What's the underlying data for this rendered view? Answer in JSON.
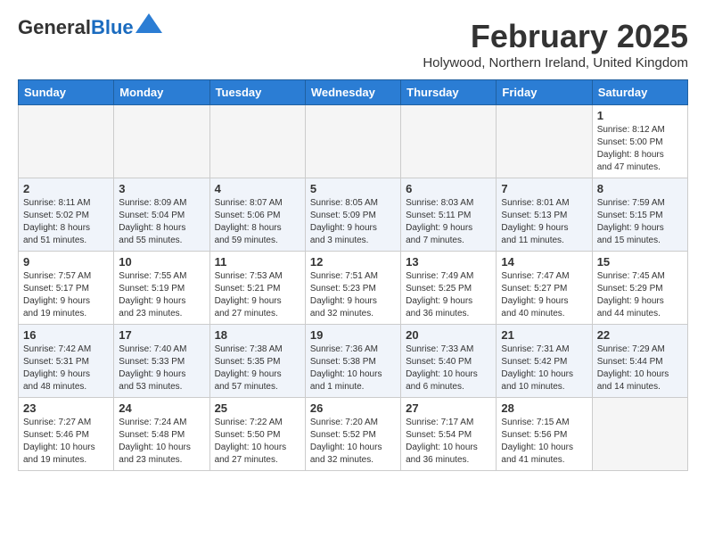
{
  "logo": {
    "general": "General",
    "blue": "Blue"
  },
  "title": "February 2025",
  "location": "Holywood, Northern Ireland, United Kingdom",
  "days_of_week": [
    "Sunday",
    "Monday",
    "Tuesday",
    "Wednesday",
    "Thursday",
    "Friday",
    "Saturday"
  ],
  "weeks": [
    [
      {
        "day": "",
        "info": ""
      },
      {
        "day": "",
        "info": ""
      },
      {
        "day": "",
        "info": ""
      },
      {
        "day": "",
        "info": ""
      },
      {
        "day": "",
        "info": ""
      },
      {
        "day": "",
        "info": ""
      },
      {
        "day": "1",
        "info": "Sunrise: 8:12 AM\nSunset: 5:00 PM\nDaylight: 8 hours\nand 47 minutes."
      }
    ],
    [
      {
        "day": "2",
        "info": "Sunrise: 8:11 AM\nSunset: 5:02 PM\nDaylight: 8 hours\nand 51 minutes."
      },
      {
        "day": "3",
        "info": "Sunrise: 8:09 AM\nSunset: 5:04 PM\nDaylight: 8 hours\nand 55 minutes."
      },
      {
        "day": "4",
        "info": "Sunrise: 8:07 AM\nSunset: 5:06 PM\nDaylight: 8 hours\nand 59 minutes."
      },
      {
        "day": "5",
        "info": "Sunrise: 8:05 AM\nSunset: 5:09 PM\nDaylight: 9 hours\nand 3 minutes."
      },
      {
        "day": "6",
        "info": "Sunrise: 8:03 AM\nSunset: 5:11 PM\nDaylight: 9 hours\nand 7 minutes."
      },
      {
        "day": "7",
        "info": "Sunrise: 8:01 AM\nSunset: 5:13 PM\nDaylight: 9 hours\nand 11 minutes."
      },
      {
        "day": "8",
        "info": "Sunrise: 7:59 AM\nSunset: 5:15 PM\nDaylight: 9 hours\nand 15 minutes."
      }
    ],
    [
      {
        "day": "9",
        "info": "Sunrise: 7:57 AM\nSunset: 5:17 PM\nDaylight: 9 hours\nand 19 minutes."
      },
      {
        "day": "10",
        "info": "Sunrise: 7:55 AM\nSunset: 5:19 PM\nDaylight: 9 hours\nand 23 minutes."
      },
      {
        "day": "11",
        "info": "Sunrise: 7:53 AM\nSunset: 5:21 PM\nDaylight: 9 hours\nand 27 minutes."
      },
      {
        "day": "12",
        "info": "Sunrise: 7:51 AM\nSunset: 5:23 PM\nDaylight: 9 hours\nand 32 minutes."
      },
      {
        "day": "13",
        "info": "Sunrise: 7:49 AM\nSunset: 5:25 PM\nDaylight: 9 hours\nand 36 minutes."
      },
      {
        "day": "14",
        "info": "Sunrise: 7:47 AM\nSunset: 5:27 PM\nDaylight: 9 hours\nand 40 minutes."
      },
      {
        "day": "15",
        "info": "Sunrise: 7:45 AM\nSunset: 5:29 PM\nDaylight: 9 hours\nand 44 minutes."
      }
    ],
    [
      {
        "day": "16",
        "info": "Sunrise: 7:42 AM\nSunset: 5:31 PM\nDaylight: 9 hours\nand 48 minutes."
      },
      {
        "day": "17",
        "info": "Sunrise: 7:40 AM\nSunset: 5:33 PM\nDaylight: 9 hours\nand 53 minutes."
      },
      {
        "day": "18",
        "info": "Sunrise: 7:38 AM\nSunset: 5:35 PM\nDaylight: 9 hours\nand 57 minutes."
      },
      {
        "day": "19",
        "info": "Sunrise: 7:36 AM\nSunset: 5:38 PM\nDaylight: 10 hours\nand 1 minute."
      },
      {
        "day": "20",
        "info": "Sunrise: 7:33 AM\nSunset: 5:40 PM\nDaylight: 10 hours\nand 6 minutes."
      },
      {
        "day": "21",
        "info": "Sunrise: 7:31 AM\nSunset: 5:42 PM\nDaylight: 10 hours\nand 10 minutes."
      },
      {
        "day": "22",
        "info": "Sunrise: 7:29 AM\nSunset: 5:44 PM\nDaylight: 10 hours\nand 14 minutes."
      }
    ],
    [
      {
        "day": "23",
        "info": "Sunrise: 7:27 AM\nSunset: 5:46 PM\nDaylight: 10 hours\nand 19 minutes."
      },
      {
        "day": "24",
        "info": "Sunrise: 7:24 AM\nSunset: 5:48 PM\nDaylight: 10 hours\nand 23 minutes."
      },
      {
        "day": "25",
        "info": "Sunrise: 7:22 AM\nSunset: 5:50 PM\nDaylight: 10 hours\nand 27 minutes."
      },
      {
        "day": "26",
        "info": "Sunrise: 7:20 AM\nSunset: 5:52 PM\nDaylight: 10 hours\nand 32 minutes."
      },
      {
        "day": "27",
        "info": "Sunrise: 7:17 AM\nSunset: 5:54 PM\nDaylight: 10 hours\nand 36 minutes."
      },
      {
        "day": "28",
        "info": "Sunrise: 7:15 AM\nSunset: 5:56 PM\nDaylight: 10 hours\nand 41 minutes."
      },
      {
        "day": "",
        "info": ""
      }
    ]
  ]
}
